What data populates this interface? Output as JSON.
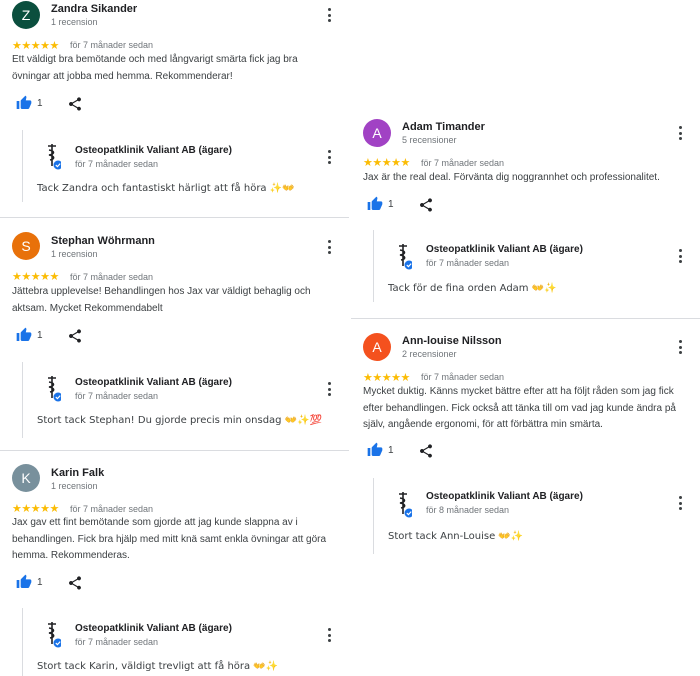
{
  "colors": {
    "star": "#fbbc04",
    "like": "#1a73e8",
    "divider": "#dadce0"
  },
  "owner": {
    "name": "Osteopatklinik Valiant AB (ägare)",
    "icon": "caduceus-logo-icon",
    "badge": "verified-check-icon"
  },
  "reviews_left": [
    {
      "avatar_letter": "Z",
      "avatar_color": "#0b4f3e",
      "name": "Zandra Sikander",
      "count": "1 recension",
      "stars": "★★★★★",
      "time": "för 7 månader sedan",
      "text": "Ett väldigt bra bemötande och med långvarigt smärta fick jag bra övningar att jobba med hemma. Rekommenderar!",
      "likes": "1",
      "reply_time": "för 7 månader sedan",
      "reply_text": "Tack Zandra och fantastiskt härligt att få höra ✨👐"
    },
    {
      "avatar_letter": "S",
      "avatar_color": "#e8710a",
      "name": "Stephan Wöhrmann",
      "count": "1 recension",
      "stars": "★★★★★",
      "time": "för 7 månader sedan",
      "text": "Jättebra upplevelse! Behandlingen hos Jax var väldigt behaglig och aktsam. Mycket Rekommendabelt",
      "likes": "1",
      "reply_time": "för 7 månader sedan",
      "reply_text": "Stort tack Stephan! Du gjorde precis min onsdag 👐✨💯"
    },
    {
      "avatar_letter": "K",
      "avatar_color": "#78909c",
      "name": "Karin Falk",
      "count": "1 recension",
      "stars": "★★★★★",
      "time": "för 7 månader sedan",
      "text": "Jax gav ett fint bemötande som gjorde att jag kunde slappna av i behandlingen. Fick bra hjälp med mitt knä samt enkla övningar att göra hemma. Rekommenderas.",
      "likes": "1",
      "reply_time": "för 7 månader sedan",
      "reply_text": "Stort tack Karin, väldigt trevligt att få höra 👐✨"
    }
  ],
  "reviews_right": [
    {
      "avatar_letter": "A",
      "avatar_color": "#a142c4",
      "name": "Adam Timander",
      "count": "5 recensioner",
      "stars": "★★★★★",
      "time": "för 7 månader sedan",
      "text": "Jax är the real deal. Förvänta dig noggrannhet och professionalitet.",
      "likes": "1",
      "reply_time": "för 7 månader sedan",
      "reply_text": "Tack för de fina orden Adam 👐✨"
    },
    {
      "avatar_letter": "A",
      "avatar_color": "#f4511e",
      "name": "Ann-louise Nilsson",
      "count": "2 recensioner",
      "stars": "★★★★★",
      "time": "för 7 månader sedan",
      "text": "Mycket duktig. Känns mycket bättre efter att ha följt råden som jag fick efter behandlingen. Fick också att tänka till om vad jag kunde ändra på själv, angående ergonomi, för att förbättra min smärta.",
      "likes": "1",
      "reply_time": "för 8 månader sedan",
      "reply_text": "Stort tack Ann-Louise 👐✨"
    }
  ]
}
